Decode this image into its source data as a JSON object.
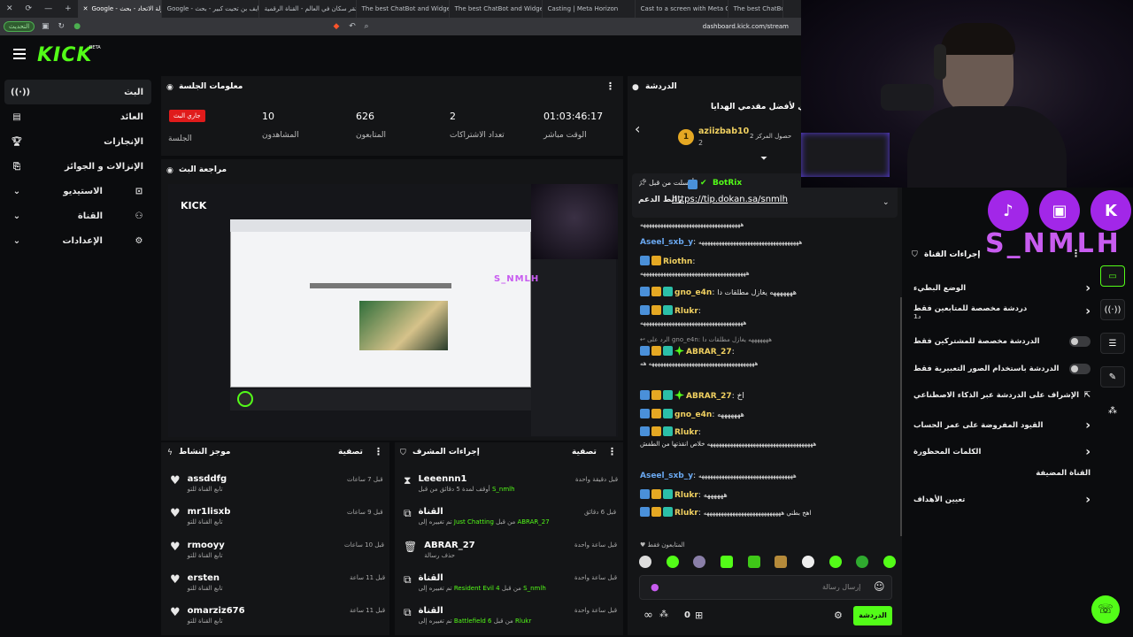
{
  "browser": {
    "tabs": [
      "Google - جولة الاتحاد - بحث",
      "Google - تايف بن تحيت كبير - بحث",
      "احتقر سكان في العالم - القناة الرقمية",
      "The best ChatBot and Widget",
      "The best ChatBot and Widget",
      "Casting | Meta Horizon",
      "Cast to a screen with Meta Qu",
      "The best ChatBot"
    ],
    "update_label": "التحديث",
    "url": "dashboard.kick.com/stream"
  },
  "logo": {
    "text": "KICK",
    "beta": "BETA"
  },
  "sidebar": {
    "items": [
      {
        "label": "البث",
        "icon": "broadcast-icon"
      },
      {
        "label": "العائد",
        "icon": "wallet-icon"
      },
      {
        "label": "الإنجازات",
        "icon": "trophy-icon"
      },
      {
        "label": "الإنزالات و الجوائز",
        "icon": "gift-icon"
      },
      {
        "label": "الاستيديو",
        "icon": "studio-icon"
      },
      {
        "label": "القناة",
        "icon": "users-icon"
      },
      {
        "label": "الإعدادات",
        "icon": "gear-icon"
      }
    ]
  },
  "session": {
    "title": "معلومات الجلسة",
    "live_badge": "جاري البث",
    "session_label": "الجلسة",
    "viewers_value": "10",
    "viewers_label": "المشاهدون",
    "followers_value": "626",
    "followers_label": "المتابعون",
    "subs_value": "2",
    "subs_label": "تعداد الاشتراكات",
    "time_value": "01:03:46:17",
    "time_label": "الوقت مباشر"
  },
  "preview": {
    "title": "مراجعة البث",
    "brand": "S_NMLH"
  },
  "activity": {
    "title": "موجز النشاط",
    "filter": "تصفية",
    "sub_text": "تابع القناة للتو",
    "items": [
      {
        "name": "assddfg",
        "time": "قبل 7 ساعات"
      },
      {
        "name": "mr1lisxb",
        "time": "قبل 9 ساعات"
      },
      {
        "name": "rmooyy",
        "time": "قبل 10 ساعات"
      },
      {
        "name": "ersten",
        "time": "قبل 11 ساعة"
      },
      {
        "name": "omarziz676",
        "time": "قبل 11 ساعة"
      }
    ]
  },
  "modactions": {
    "title": "إجراءات المشرف",
    "filter": "تصفية",
    "items": [
      {
        "name": "Leeennn1",
        "time": "قبل دقيقة واحدة",
        "sub_pre": "أوقف لمدة 5 دقائق من قبل",
        "sub_hl": "S_nmlh",
        "icon": "hourglass-icon"
      },
      {
        "name": "القناة",
        "time": "قبل 6 دقائق",
        "sub_pre": "تم تغييره إلى",
        "sub_hl": "Just Chatting",
        "sub_mid": "من قبل",
        "sub_hl2": "ABRAR_27",
        "icon": "category-icon"
      },
      {
        "name": "ABRAR_27",
        "time": "قبل ساعة واحدة",
        "sub_pre": "حذف رسالة",
        "icon": "trash-icon"
      },
      {
        "name": "القناة",
        "time": "قبل ساعة واحدة",
        "sub_pre": "تم تغييره إلى",
        "sub_hl": "Resident Evil 4",
        "sub_mid": "من قبل",
        "sub_hl2": "S_nmlh",
        "icon": "category-icon"
      },
      {
        "name": "القناة",
        "time": "قبل ساعة واحدة",
        "sub_pre": "تم تغييره إلى",
        "sub_hl": "Battlefield 6",
        "sub_mid": "من قبل",
        "sub_hl2": "Rlukr",
        "icon": "category-icon"
      }
    ]
  },
  "chat": {
    "title": "الدردشة",
    "leader_title": "الشهري لأفضل مقدمي الهدايا",
    "leader_user": "aziizbab10",
    "leader_count": "2",
    "leader_rank": "1",
    "leader_side": "حصول المركز 2",
    "pinned_from": "أرسلت من قبل",
    "pinned_user": "BotRix",
    "pinned_label": "رابط الدعم",
    "pinned_link": "https://tip.dokan.sa/snmlh",
    "messages": [
      {
        "user": "",
        "text": "هههههههههههههههههههههههههههههههههههه"
      },
      {
        "user": "Aseel_sxb_y",
        "text": "هههههههههههههههههههههههههههههههههههه"
      },
      {
        "user": "Riothn",
        "text": "هههههههههههههههههههههههههههههههههههههه"
      },
      {
        "user": "gno_e4n",
        "text": "هههههههه يغازل مطلقات دا"
      },
      {
        "user": "Rlukr",
        "text": "ههههههههههههههههههههههههههههههههههههه"
      },
      {
        "user": "ABRAR_27",
        "text": "هههههههههههههههههههههههههههههههههههههه هه",
        "reply": "الرد على gno_e4n: هههههههه يغازل مطلقات دا"
      },
      {
        "user": "ABRAR_27",
        "text": "اخ"
      },
      {
        "user": "gno_e4n",
        "text": "هههههههه"
      },
      {
        "user": "Rlukr",
        "text": "هههههههههههههههههههههههههههههههههههههه خلاص انقذتها من الطفش"
      },
      {
        "user": "Aseel_sxb_y",
        "text": "هههههههههههههههههههههههههههههههههه"
      },
      {
        "user": "Rlukr",
        "text": "ههههههه"
      },
      {
        "user": "Rlukr",
        "text": "اهخ بطني هههههههههههههههههههههههههههه"
      }
    ],
    "followers_only": "المتابعون فقط",
    "input_placeholder": "إرسال رسالة",
    "points": "0",
    "send_label": "الدردشة"
  },
  "modtools": {
    "title": "إجراءات القناة",
    "items": [
      {
        "label": "الوضع البطيء",
        "kind": "chevron"
      },
      {
        "label": "دردشة مخصصة للمتابعين فقط",
        "sub": "1د",
        "kind": "chevron"
      },
      {
        "label": "الدردشة مخصصة للمشتركين فقط",
        "kind": "toggle"
      },
      {
        "label": "الدردشة باستخدام الصور التعبيرية فقط",
        "kind": "toggle"
      },
      {
        "label": "الإشراف على الدردشة عبر الذكاء الاصطناعي",
        "kind": "external"
      },
      {
        "label": "القيود المفروضة على عمر الحساب",
        "kind": "chevron"
      },
      {
        "label": "الكلمات المحظورة",
        "kind": "chevron"
      },
      {
        "label": "القناة المضيفة",
        "kind": "none"
      },
      {
        "label": "تعيين الأهداف",
        "kind": "chevron"
      }
    ]
  },
  "overlay": {
    "brand": "S_NMLH",
    "socials": [
      "TikTok",
      "Twitch",
      "Kick"
    ]
  },
  "colors": {
    "accent": "#53fc18",
    "live": "#e01b1b",
    "brand_purple": "#a227e8"
  }
}
